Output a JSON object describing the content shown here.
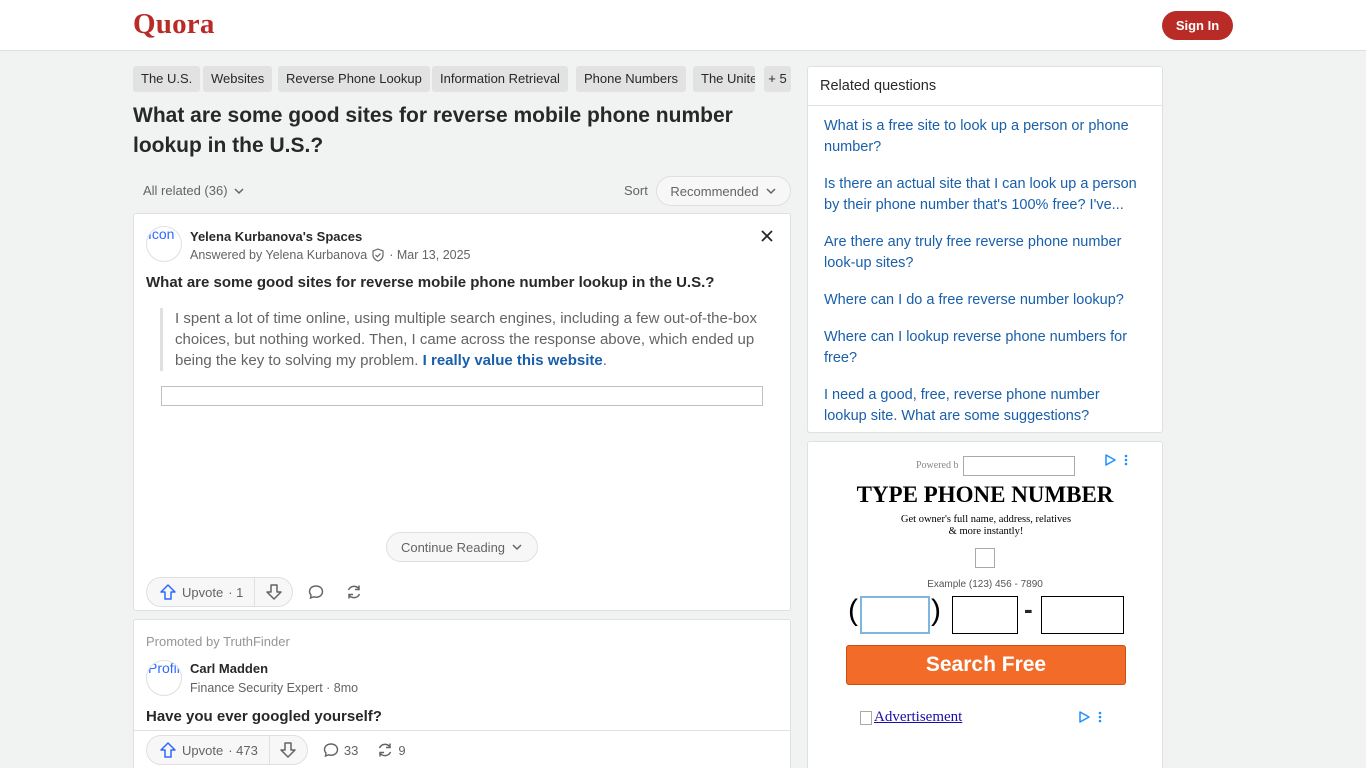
{
  "header": {
    "logo": "Quora",
    "signin_label": "Sign In"
  },
  "topics": [
    "The U.S.",
    "Websites",
    "Reverse Phone Lookup",
    "Information Retrieval",
    "Phone Numbers",
    "The United States"
  ],
  "more_topics": "+ 5",
  "question_title": "What are some good sites for reverse mobile phone number lookup in the U.S.?",
  "filter": {
    "all_related": "All related (36)",
    "sort_label": "Sort",
    "sort_value": "Recommended"
  },
  "answer": {
    "avatar_alt": "Icon",
    "space_name": "Yelena Kurbanova's Spaces",
    "answered_by": "Answered by Yelena Kurbanova",
    "date": "· Mar 13, 2025",
    "title": "What are some good sites for reverse mobile phone number lookup in the U.S.?",
    "body": "I spent a lot of time online, using multiple search engines, including a few out-of-the-box choices, but nothing worked. Then, I came across the response above, which ended up being the key to solving my problem.",
    "link_text": "I really value this website",
    "after_link": ".",
    "continue_label": "Continue Reading",
    "upvote_label": "Upvote",
    "upvote_count": "· 1"
  },
  "promo": {
    "promoted_by": "Promoted by TruthFinder",
    "avatar_alt": "Profil",
    "author": "Carl Madden",
    "meta": "Finance Security Expert · 8mo",
    "title": "Have you ever googled yourself?",
    "upvote_label": "Upvote",
    "upvote_count": "· 473",
    "comments": "33",
    "shares": "9"
  },
  "related": {
    "heading": "Related questions",
    "items": [
      "What is a free site to look up a person or phone number?",
      "Is there an actual site that I can look up a person by their phone number that's 100% free? I've...",
      "Are there any truly free reverse phone number look-up sites?",
      "Where can I do a free reverse number lookup?",
      "Where can I lookup reverse phone numbers for free?",
      "I need a good, free, reverse phone number lookup site. What are some suggestions?"
    ]
  },
  "ad": {
    "powered_by": "Powered b",
    "title": "TYPE PHONE NUMBER",
    "subtitle_line1": "Get owner's full name, address, relatives",
    "subtitle_line2": "& more instantly!",
    "example": "Example (123) 456 - 7890",
    "button": "Search Free",
    "advertisement_link": "Advertisement"
  },
  "colors": {
    "brand": "#b92b27",
    "link": "#195faa",
    "ad_button": "#f26b28"
  }
}
